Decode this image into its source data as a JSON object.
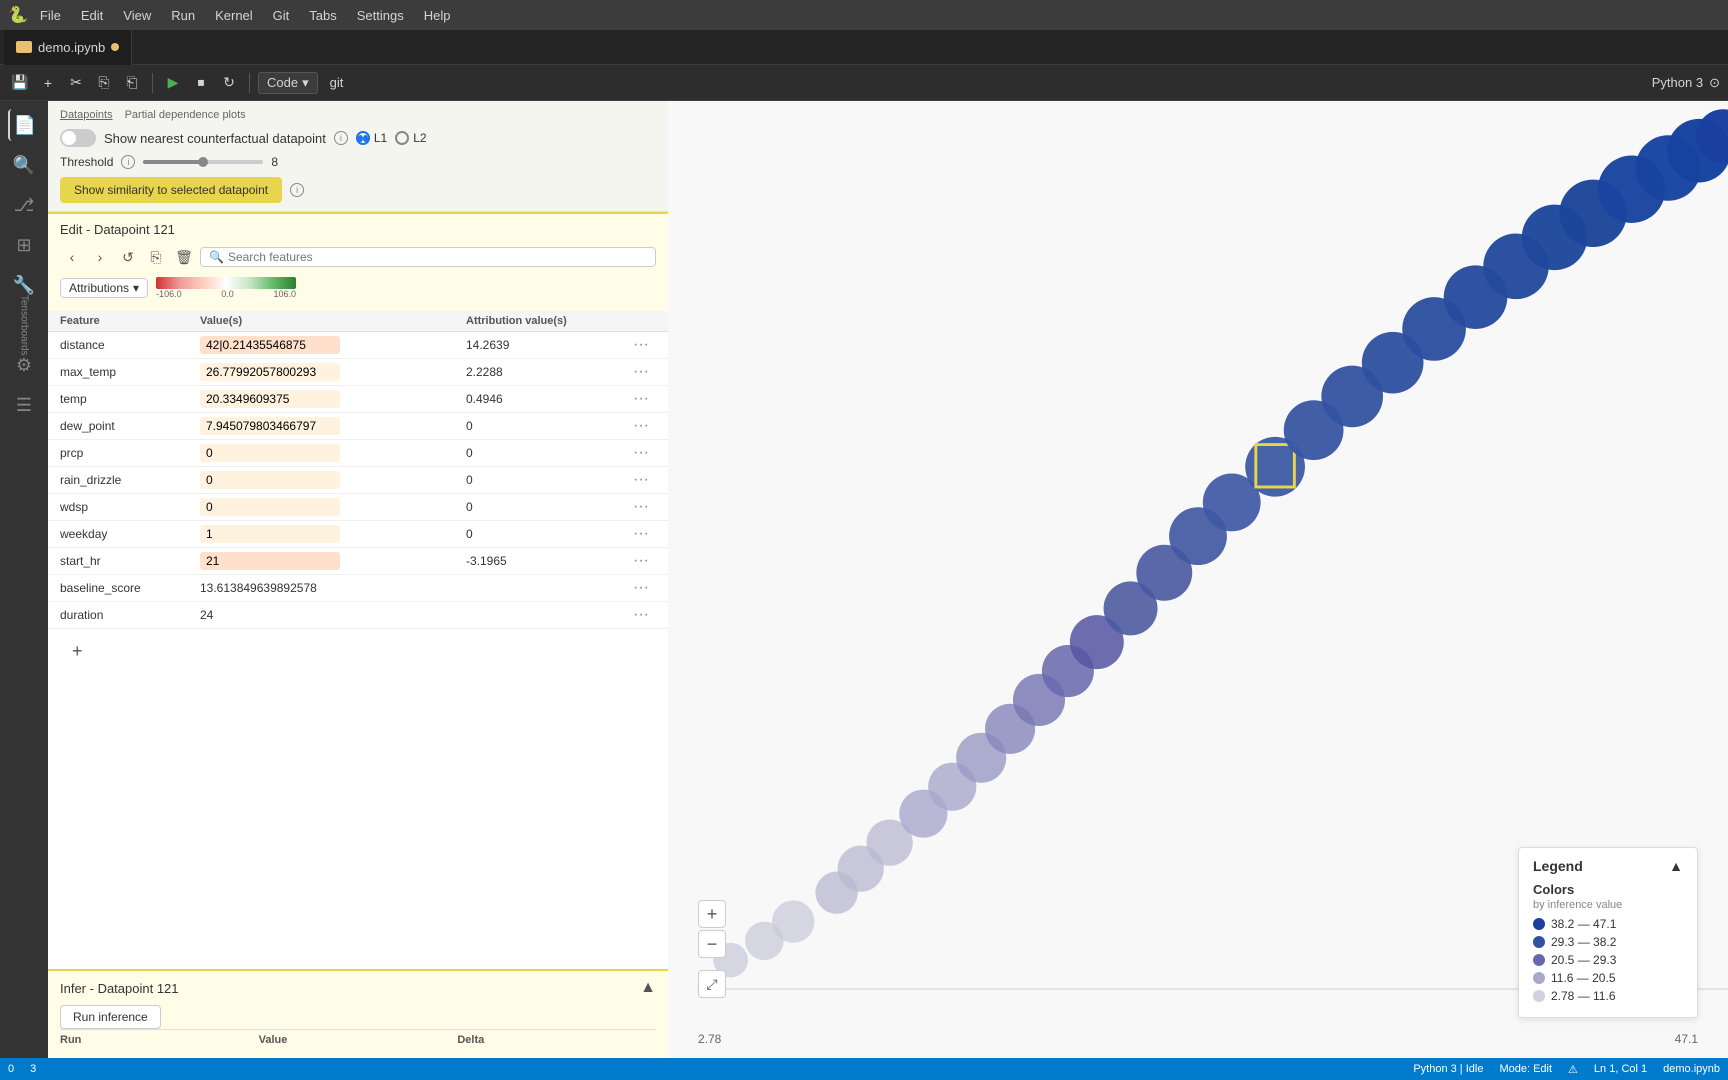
{
  "menu": {
    "logo": "🐍",
    "items": [
      "File",
      "Edit",
      "View",
      "Run",
      "Kernel",
      "Git",
      "Tabs",
      "Settings",
      "Help"
    ]
  },
  "tab": {
    "label": "demo.ipynb",
    "modified": true
  },
  "toolbar": {
    "save": "💾",
    "add_cell": "+",
    "cut": "✂",
    "copy": "📋",
    "paste": "📋",
    "run": "▶",
    "stop": "⏹",
    "restart": "↻",
    "kernel_label": "Code",
    "git_label": "git",
    "python_label": "Python 3"
  },
  "panel": {
    "nearest_counterfactual_label": "Show nearest counterfactual datapoint",
    "l1_label": "L1",
    "l2_label": "L2",
    "threshold_label": "Threshold",
    "threshold_value": "8",
    "similarity_btn": "Show similarity to selected datapoint",
    "edit_title": "Edit - Datapoint 121",
    "search_placeholder": "Search features",
    "attributions_label": "Attributions",
    "color_bar_min": "-106.0",
    "color_bar_mid": "0.0",
    "color_bar_max": "106.0",
    "table": {
      "headers": [
        "Feature",
        "Value(s)",
        "Attribution value(s)",
        ""
      ],
      "rows": [
        {
          "feature": "distance",
          "value": "42|0.21435546875",
          "value_display": "42|0.21435546875",
          "attribution": "14.2639",
          "highlight": "orange"
        },
        {
          "feature": "max_temp",
          "value": "26.77992057800293",
          "attribution": "2.2288",
          "highlight": "light-orange"
        },
        {
          "feature": "temp",
          "value": "20.3349609375",
          "attribution": "0.4946",
          "highlight": "light-orange"
        },
        {
          "feature": "dew_point",
          "value": "7.945079803466797",
          "attribution": "0",
          "highlight": "light-orange"
        },
        {
          "feature": "prcp",
          "value": "0",
          "attribution": "0",
          "highlight": "light-orange"
        },
        {
          "feature": "rain_drizzle",
          "value": "0",
          "attribution": "0",
          "highlight": "light-orange"
        },
        {
          "feature": "wdsp",
          "value": "0",
          "attribution": "0",
          "highlight": "light-orange"
        },
        {
          "feature": "weekday",
          "value": "1",
          "attribution": "0",
          "highlight": "light-orange"
        },
        {
          "feature": "start_hr",
          "value": "21",
          "attribution": "-3.1965",
          "highlight": "orange"
        },
        {
          "feature": "baseline_score",
          "value": "13.613849639892578",
          "attribution": "",
          "highlight": "none"
        },
        {
          "feature": "duration",
          "value": "24",
          "attribution": "",
          "highlight": "none"
        }
      ]
    },
    "add_feature_btn": "+",
    "infer_title": "Infer - Datapoint 121",
    "run_inference_btn": "Run inference",
    "infer_headers": [
      "Run",
      "Value",
      "Delta"
    ]
  },
  "legend": {
    "title": "Legend",
    "colors_title": "Colors",
    "subtitle": "by inference value",
    "items": [
      {
        "label": "38.2 — 47.1",
        "color": "#3949ab"
      },
      {
        "label": "29.3 — 38.2",
        "color": "#5c6bc0"
      },
      {
        "label": "20.5 — 29.3",
        "color": "#9fa8da"
      },
      {
        "label": "11.6 — 20.5",
        "color": "#d0d0e0"
      },
      {
        "label": "2.78 — 11.6",
        "color": "#e8e8f0"
      }
    ]
  },
  "axis": {
    "min": "2.78",
    "max": "47.1"
  },
  "status": {
    "branch": "0",
    "cells": "3",
    "kernel": "Python 3 | Idle",
    "mode": "Mode: Edit",
    "position": "Ln 1, Col 1",
    "file": "demo.ipynb"
  }
}
